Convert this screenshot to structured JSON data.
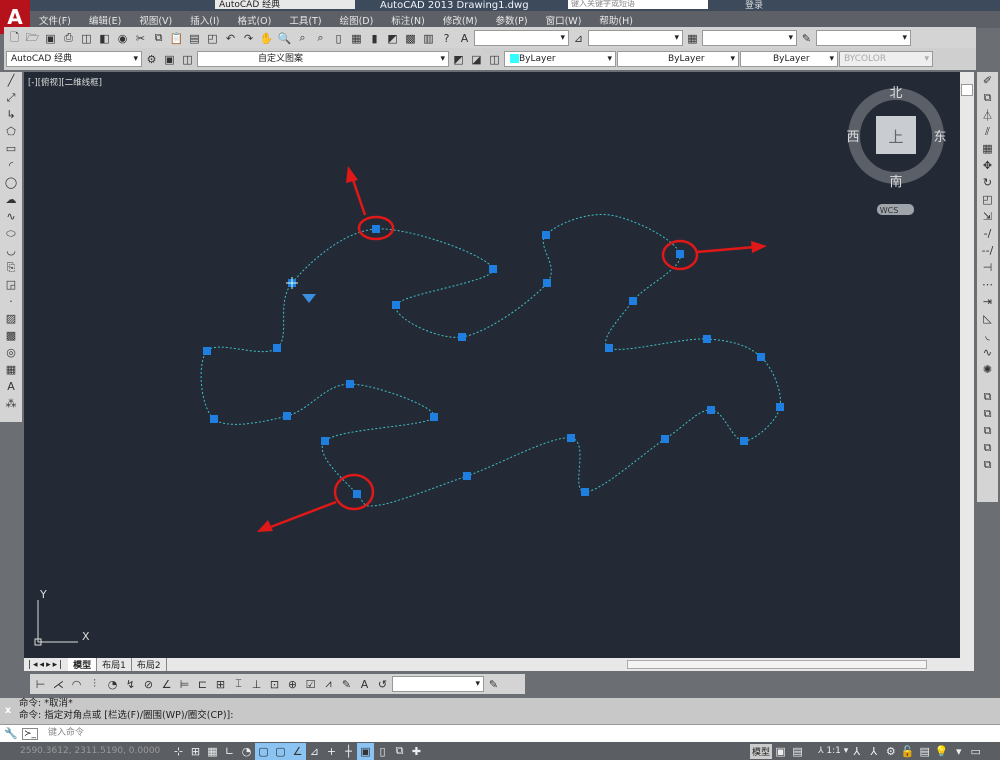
{
  "title_bar": {
    "workspace": "AutoCAD 经典",
    "app_title": "AutoCAD 2013    Drawing1.dwg",
    "search_placeholder": "键入关键字或短语",
    "user": "登录"
  },
  "menu": [
    "文件(F)",
    "编辑(E)",
    "视图(V)",
    "插入(I)",
    "格式(O)",
    "工具(T)",
    "绘图(D)",
    "标注(N)",
    "修改(M)",
    "参数(P)",
    "窗口(W)",
    "帮助(H)"
  ],
  "toolbar2": {
    "workspace": "AutoCAD 经典",
    "layer": "自定义图案",
    "color": "ByLayer",
    "linetype": "ByLayer",
    "lineweight": "ByLayer",
    "plotstyle": "BYCOLOR"
  },
  "viewport_label": "[-][俯视][二维线框]",
  "viewcube": {
    "north": "北",
    "south": "南",
    "east": "东",
    "west": "西",
    "face": "上",
    "wcs": "WCS"
  },
  "ucs": {
    "x": "X",
    "y": "Y"
  },
  "layout_tabs": [
    "模型",
    "布局1",
    "布局2"
  ],
  "command": {
    "line1": "命令: *取消*",
    "line2": "命令: 指定对角点或 [栏选(F)/圈围(WP)/圈交(CP)]:",
    "placeholder": "键入命令"
  },
  "status": {
    "coords": "2590.3612, 2311.5190, 0.0000",
    "model": "模型",
    "scale": "1:1"
  },
  "colors": {
    "canvas": "#232a35",
    "spline": "#3fc1c9",
    "grip": "#1e7fe0",
    "annotation": "#e01818"
  }
}
